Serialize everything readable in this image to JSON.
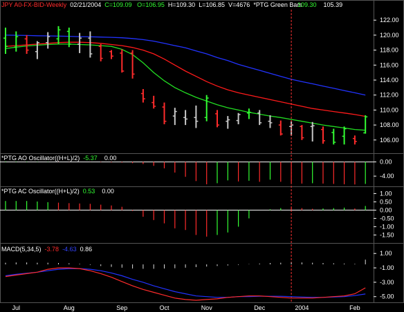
{
  "header": {
    "symbol": "JPY A0-FX-BID-Weekly",
    "date": "02/21/2004",
    "close": "C=109.09",
    "open": "O=106.95",
    "high": "H=109.30",
    "low": "L=106.85",
    "volume": "V=4676",
    "study": "*PTG Green Bars",
    "study_v1": "109.30",
    "study_v2": "105.39"
  },
  "panels": {
    "ao": {
      "label": "*PTG AO Oscillator((H+L)/2)",
      "v1": "-5.37",
      "v2": "0.00"
    },
    "ac": {
      "label": "*PTG AC Oscillator((H+L)/2)",
      "v1": "0.53",
      "v2": "0.00"
    },
    "macd": {
      "label": "MACD(5,34,5)",
      "v1": "-3.78",
      "v2": "-4.63",
      "v3": "0.86"
    }
  },
  "colors": {
    "up": "#33ff33",
    "down": "#ff2b2b",
    "ma_slow": "#2233ff",
    "ma_mid": "#ff1a1a",
    "ma_fast": "#22dd22",
    "neutral": "#c8c8c8",
    "grid": "#ffffff",
    "cursor": "#ff3333"
  },
  "chart_data": [
    {
      "type": "ohlc",
      "panel": "price",
      "x_labels": [
        "Jul",
        "Aug",
        "Sep",
        "Oct",
        "Nov",
        "Dec",
        "2004",
        "Feb"
      ],
      "x_label_weeks": [
        1,
        6,
        11,
        15,
        19,
        24,
        28,
        33
      ],
      "y_ticks": [
        106,
        108,
        110,
        112,
        114,
        116,
        118,
        120,
        122
      ],
      "ylim": [
        104.6,
        123.4
      ],
      "bars": [
        {
          "o": 119.6,
          "h": 121.0,
          "l": 117.5,
          "c": 118.5,
          "col": "up"
        },
        {
          "o": 118.4,
          "h": 120.5,
          "l": 117.8,
          "c": 119.8,
          "col": "up"
        },
        {
          "o": 119.5,
          "h": 120.0,
          "l": 117.5,
          "c": 118.0,
          "col": "down"
        },
        {
          "o": 117.8,
          "h": 119.2,
          "l": 116.8,
          "c": 119.0,
          "col": "neutral"
        },
        {
          "o": 119.0,
          "h": 120.4,
          "l": 118.2,
          "c": 119.8,
          "col": "neutral"
        },
        {
          "o": 119.5,
          "h": 121.2,
          "l": 118.8,
          "c": 120.7,
          "col": "up"
        },
        {
          "o": 120.5,
          "h": 121.0,
          "l": 118.4,
          "c": 118.8,
          "col": "up"
        },
        {
          "o": 118.8,
          "h": 120.3,
          "l": 117.6,
          "c": 119.6,
          "col": "neutral"
        },
        {
          "o": 119.6,
          "h": 120.5,
          "l": 117.0,
          "c": 117.5,
          "col": "neutral"
        },
        {
          "o": 118.5,
          "h": 118.8,
          "l": 116.5,
          "c": 116.9,
          "col": "down"
        },
        {
          "o": 117.8,
          "h": 118.0,
          "l": 116.8,
          "c": 117.2,
          "col": "down"
        },
        {
          "o": 117.6,
          "h": 118.1,
          "l": 115.0,
          "c": 115.2,
          "col": "down"
        },
        {
          "o": 117.6,
          "h": 118.0,
          "l": 114.2,
          "c": 114.8,
          "col": "down"
        },
        {
          "o": 112.2,
          "h": 112.8,
          "l": 111.0,
          "c": 111.5,
          "col": "down"
        },
        {
          "o": 111.0,
          "h": 111.9,
          "l": 110.2,
          "c": 110.5,
          "col": "down"
        },
        {
          "o": 110.4,
          "h": 111.0,
          "l": 108.1,
          "c": 108.5,
          "col": "down"
        },
        {
          "o": 109.2,
          "h": 110.3,
          "l": 108.0,
          "c": 109.8,
          "col": "neutral"
        },
        {
          "o": 109.0,
          "h": 110.0,
          "l": 108.0,
          "c": 108.8,
          "col": "neutral"
        },
        {
          "o": 109.0,
          "h": 110.6,
          "l": 107.6,
          "c": 108.5,
          "col": "neutral"
        },
        {
          "o": 109.0,
          "h": 112.0,
          "l": 108.5,
          "c": 111.6,
          "col": "up"
        },
        {
          "o": 109.5,
          "h": 110.0,
          "l": 107.7,
          "c": 108.0,
          "col": "down"
        },
        {
          "o": 108.5,
          "h": 109.2,
          "l": 107.5,
          "c": 108.7,
          "col": "neutral"
        },
        {
          "o": 108.6,
          "h": 109.6,
          "l": 108.1,
          "c": 109.4,
          "col": "neutral"
        },
        {
          "o": 109.6,
          "h": 110.2,
          "l": 108.8,
          "c": 109.7,
          "col": "up"
        },
        {
          "o": 109.6,
          "h": 110.0,
          "l": 108.0,
          "c": 108.3,
          "col": "neutral"
        },
        {
          "o": 108.5,
          "h": 109.3,
          "l": 107.6,
          "c": 108.3,
          "col": "neutral"
        },
        {
          "o": 108.0,
          "h": 108.6,
          "l": 106.6,
          "c": 106.8,
          "col": "down"
        },
        {
          "o": 107.8,
          "h": 108.5,
          "l": 106.6,
          "c": 108.0,
          "col": "neutral"
        },
        {
          "o": 107.8,
          "h": 108.0,
          "l": 106.0,
          "c": 106.3,
          "col": "down"
        },
        {
          "o": 107.8,
          "h": 108.4,
          "l": 105.8,
          "c": 107.9,
          "col": "neutral"
        },
        {
          "o": 107.4,
          "h": 107.8,
          "l": 105.5,
          "c": 105.9,
          "col": "down"
        },
        {
          "o": 107.0,
          "h": 107.5,
          "l": 105.4,
          "c": 105.7,
          "col": "up"
        },
        {
          "o": 106.5,
          "h": 107.8,
          "l": 105.4,
          "c": 107.5,
          "col": "up"
        },
        {
          "o": 106.2,
          "h": 106.6,
          "l": 105.4,
          "c": 105.8,
          "col": "down"
        },
        {
          "o": 106.95,
          "h": 109.3,
          "l": 106.85,
          "c": 109.09,
          "col": "up"
        }
      ],
      "ma_slow": [
        120.0,
        119.98,
        119.95,
        119.92,
        119.9,
        119.87,
        119.84,
        119.8,
        119.78,
        119.74,
        119.7,
        119.65,
        119.55,
        119.4,
        119.2,
        118.9,
        118.6,
        118.3,
        117.9,
        117.5,
        117.0,
        116.6,
        116.1,
        115.7,
        115.3,
        114.9,
        114.5,
        114.1,
        113.8,
        113.5,
        113.2,
        112.9,
        112.6,
        112.3,
        112.0
      ],
      "ma_mid": [
        118.5,
        118.6,
        118.7,
        118.8,
        118.9,
        119.0,
        119.05,
        119.05,
        119.0,
        118.9,
        118.75,
        118.6,
        118.35,
        118.0,
        117.5,
        116.8,
        116.0,
        115.2,
        114.5,
        113.8,
        113.2,
        112.7,
        112.3,
        112.0,
        111.7,
        111.4,
        111.1,
        110.8,
        110.5,
        110.2,
        110.0,
        109.8,
        109.6,
        109.4,
        109.15
      ],
      "ma_fast": [
        118.2,
        118.4,
        118.55,
        118.65,
        118.75,
        118.8,
        118.8,
        118.75,
        118.7,
        118.6,
        118.5,
        118.1,
        117.4,
        116.3,
        115.0,
        113.9,
        113.0,
        112.3,
        111.7,
        111.2,
        110.7,
        110.3,
        110.0,
        109.7,
        109.45,
        109.2,
        109.0,
        108.75,
        108.5,
        108.25,
        108.0,
        107.8,
        107.6,
        107.4,
        107.3
      ]
    },
    {
      "type": "bar",
      "panel": "ao",
      "y_ticks": [
        "0.00",
        "-4.00"
      ],
      "ylim": [
        -6.5,
        0.5
      ],
      "values": [
        0.15,
        0.12,
        0.1,
        0.08,
        0.07,
        0.05,
        0.03,
        0.01,
        -0.02,
        -0.1,
        -0.15,
        -0.2,
        -0.35,
        -0.6,
        -1.1,
        -1.8,
        -3.0,
        -4.2,
        -5.4,
        -6.3,
        -6.0,
        -5.2,
        -5.5,
        -5.3,
        -5.6,
        -5.0,
        -5.6,
        -5.9,
        -6.1,
        -6.0,
        -6.1,
        -6.2,
        -6.3,
        -6.35,
        -6.2
      ],
      "colors": [
        "up",
        "up",
        "up",
        "up",
        "up",
        "down",
        "down",
        "down",
        "down",
        "down",
        "down",
        "down",
        "down",
        "down",
        "down",
        "down",
        "down",
        "down",
        "down",
        "down",
        "up",
        "up",
        "down",
        "up",
        "down",
        "up",
        "down",
        "down",
        "down",
        "up",
        "down",
        "down",
        "down",
        "down",
        "up"
      ]
    },
    {
      "type": "bar",
      "panel": "ac",
      "y_ticks": [
        "1.00",
        "0.50",
        "0.00",
        "-0.50",
        "-1.00",
        "-1.50"
      ],
      "ylim": [
        -1.9,
        1.1
      ],
      "values": [
        0.55,
        0.55,
        0.55,
        0.52,
        0.48,
        0.45,
        0.42,
        0.4,
        0.38,
        0.33,
        0.28,
        0.2,
        -0.05,
        -0.4,
        -0.6,
        -0.8,
        -1.1,
        -1.2,
        -1.5,
        -1.6,
        -1.5,
        -1.35,
        -1.0,
        -0.5,
        0.0,
        0.05,
        0.12,
        0.18,
        0.12,
        0.08,
        0.1,
        0.12,
        0.15,
        0.1,
        0.25
      ],
      "colors": [
        "up",
        "up",
        "up",
        "up",
        "up",
        "down",
        "down",
        "down",
        "down",
        "down",
        "down",
        "down",
        "down",
        "down",
        "down",
        "down",
        "down",
        "down",
        "down",
        "down",
        "up",
        "up",
        "up",
        "up",
        "up",
        "up",
        "up",
        "down",
        "down",
        "down",
        "up",
        "up",
        "up",
        "down",
        "up"
      ]
    },
    {
      "type": "line",
      "panel": "macd",
      "y_ticks": [
        "1.00",
        "-1.00",
        "-3.00",
        "-5.00"
      ],
      "ylim": [
        -5.6,
        1.5
      ],
      "histogram": [
        0.3,
        0.35,
        0.35,
        0.3,
        0.3,
        0.25,
        0.2,
        0.1,
        -0.1,
        -0.3,
        -0.45,
        -0.6,
        -0.75,
        -0.8,
        -0.8,
        -0.75,
        -0.7,
        -0.6,
        -0.5,
        -0.4,
        -0.3,
        -0.2,
        -0.1,
        0.05,
        0.15,
        0.25,
        0.3,
        0.35,
        0.35,
        0.3,
        0.25,
        0.2,
        0.15,
        0.1,
        0.86
      ],
      "macd": [
        -2.2,
        -2.0,
        -1.8,
        -1.6,
        -1.2,
        -1.0,
        -1.0,
        -1.1,
        -1.4,
        -1.8,
        -2.3,
        -2.9,
        -3.5,
        -4.0,
        -4.4,
        -4.8,
        -5.2,
        -5.4,
        -5.5,
        -5.4,
        -5.3,
        -5.1,
        -5.0,
        -4.9,
        -4.9,
        -5.0,
        -5.1,
        -5.2,
        -5.2,
        -5.2,
        -5.1,
        -5.0,
        -4.9,
        -4.6,
        -3.78
      ],
      "signal": [
        -2.1,
        -1.9,
        -1.75,
        -1.6,
        -1.4,
        -1.2,
        -1.1,
        -1.1,
        -1.2,
        -1.4,
        -1.7,
        -2.1,
        -2.6,
        -3.0,
        -3.5,
        -3.9,
        -4.3,
        -4.6,
        -4.9,
        -5.0,
        -5.1,
        -5.1,
        -5.0,
        -5.0,
        -4.95,
        -4.95,
        -4.95,
        -5.0,
        -5.05,
        -5.1,
        -5.1,
        -5.05,
        -5.0,
        -4.85,
        -4.63
      ]
    }
  ]
}
